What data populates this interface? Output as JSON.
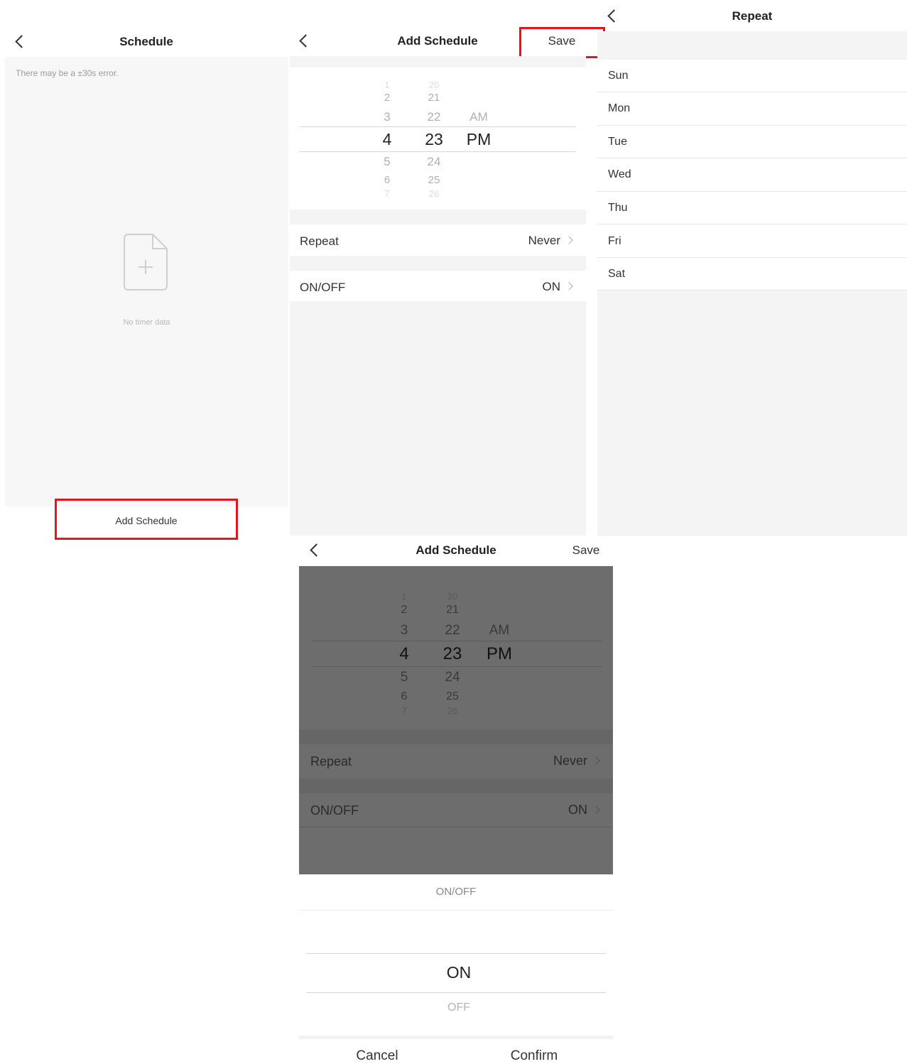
{
  "schedule_screen": {
    "title": "Schedule",
    "note": "There may be a ±30s error.",
    "empty_text": "No timer data",
    "add_button": "Add Schedule"
  },
  "add_schedule_screen": {
    "title": "Add Schedule",
    "save": "Save",
    "picker": {
      "hours": [
        "1",
        "2",
        "3",
        "4",
        "5",
        "6",
        "7"
      ],
      "minutes": [
        "20",
        "21",
        "22",
        "23",
        "24",
        "25",
        "26"
      ],
      "ampm": [
        "AM",
        "PM"
      ],
      "selected_hour": "4",
      "selected_minute": "23",
      "selected_ampm": "PM"
    },
    "rows": [
      {
        "label": "Repeat",
        "value": "Never"
      },
      {
        "label": "ON/OFF",
        "value": "ON"
      }
    ]
  },
  "repeat_screen": {
    "title": "Repeat",
    "days": [
      "Sun",
      "Mon",
      "Tue",
      "Wed",
      "Thu",
      "Fri",
      "Sat"
    ]
  },
  "onoff_sheet": {
    "title": "ON/OFF",
    "options": [
      "ON",
      "OFF"
    ],
    "selected": "ON",
    "cancel": "Cancel",
    "confirm": "Confirm"
  },
  "colors": {
    "highlight": "#e8141c",
    "overlay": "#6d6d6d"
  }
}
